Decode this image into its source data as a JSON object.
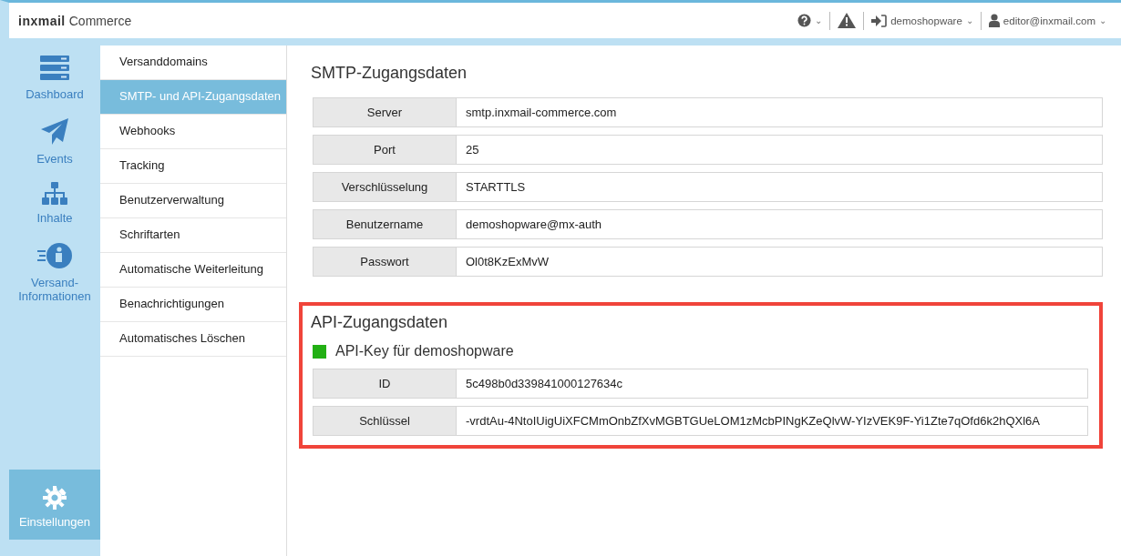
{
  "header": {
    "logo": "inxmail",
    "product": "Commerce",
    "help_caret": "⌄",
    "account": "demoshopware",
    "account_caret": "⌄",
    "user": "editor@inxmail.com",
    "user_caret": "⌄"
  },
  "nav": [
    {
      "label": "Dashboard",
      "kind": "server",
      "selected": false
    },
    {
      "label": "Events",
      "kind": "plane",
      "selected": false
    },
    {
      "label": "Inhalte",
      "kind": "sitemap",
      "selected": false
    },
    {
      "label": "Versand-Informationen",
      "kind": "info",
      "selected": false
    },
    {
      "label": "Einstellungen",
      "kind": "gear",
      "selected": true
    }
  ],
  "submenu": [
    {
      "label": "Versanddomains",
      "selected": false
    },
    {
      "label": "SMTP- und API-Zugangsdaten",
      "selected": true
    },
    {
      "label": "Webhooks",
      "selected": false
    },
    {
      "label": "Tracking",
      "selected": false
    },
    {
      "label": "Benutzerverwaltung",
      "selected": false
    },
    {
      "label": "Schriftarten",
      "selected": false
    },
    {
      "label": "Automatische Weiterleitung",
      "selected": false
    },
    {
      "label": "Benachrichtigungen",
      "selected": false
    },
    {
      "label": "Automatisches Löschen",
      "selected": false
    }
  ],
  "smtp": {
    "title": "SMTP-Zugangsdaten",
    "rows": [
      {
        "label": "Server",
        "value": "smtp.inxmail-commerce.com"
      },
      {
        "label": "Port",
        "value": "25"
      },
      {
        "label": "Verschlüsselung",
        "value": "STARTTLS"
      },
      {
        "label": "Benutzername",
        "value": "demoshopware@mx-auth"
      },
      {
        "label": "Passwort",
        "value": "Ol0t8KzExMvW"
      }
    ]
  },
  "api": {
    "title": "API-Zugangsdaten",
    "highlighted": true,
    "key_title": "API-Key für demoshopware",
    "rows": [
      {
        "label": "ID",
        "value": "5c498b0d339841000127634c"
      },
      {
        "label": "Schlüssel",
        "value": "-vrdtAu-4NtoIUigUiXFCMmOnbZfXvMGBTGUeLOM1zMcbPINgKZeQlvW-YIzVEK9F-Yi1Zte7qOfd6k2hQXl6A"
      }
    ]
  }
}
